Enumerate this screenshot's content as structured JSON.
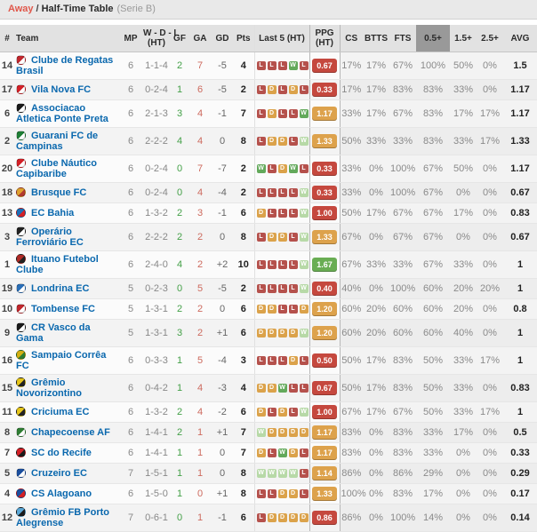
{
  "title": {
    "away": "Away",
    "sep": "/",
    "main": "Half-Time Table",
    "league": "(Serie B)"
  },
  "columns": {
    "num": "#",
    "team": "Team",
    "mp": "MP",
    "wdl1": "W - D - L",
    "wdl2": "(HT)",
    "gf": "GF",
    "ga": "GA",
    "gd": "GD",
    "pts": "Pts",
    "last5": "Last 5 (HT)",
    "ppg1": "PPG",
    "ppg2": "(HT)",
    "cs": "CS",
    "btts": "BTTS",
    "fts": "FTS",
    "o05": "0.5+",
    "o15": "1.5+",
    "o25": "2.5+",
    "avg": "AVG"
  },
  "colors": {
    "accent_away": "#e0584b",
    "team_link": "#0a68ae",
    "gf_green": "#44a048",
    "ga_red": "#cd6a5e",
    "win_box": "#63a95b",
    "win_box_light": "#b7d9a7",
    "draw_box": "#dba24a",
    "loss_box": "#b5514c",
    "ppg_red": "#c5483e",
    "ppg_orange": "#dda24c",
    "ppg_green": "#69ad53",
    "highlight_col_bg": "#999999"
  },
  "rows": [
    {
      "num": "14",
      "team": "Clube de Regatas Brasil",
      "crest": [
        "#c1272d",
        "#ffffff"
      ],
      "mp": "6",
      "wdl": "1-1-4",
      "gf": "2",
      "ga": "7",
      "gd": "-5",
      "pts": "4",
      "last5": [
        {
          "r": "L"
        },
        {
          "r": "L"
        },
        {
          "r": "L"
        },
        {
          "r": "W"
        },
        {
          "r": "L"
        }
      ],
      "ppg": "0.67",
      "ppg_color": "red",
      "cs": "17%",
      "btts": "17%",
      "fts": "67%",
      "o05": "100%",
      "o15": "50%",
      "o25": "0%",
      "avg": "1.5"
    },
    {
      "num": "17",
      "team": "Vila Nova FC",
      "crest": [
        "#d42027",
        "#ffffff"
      ],
      "mp": "6",
      "wdl": "0-2-4",
      "gf": "1",
      "ga": "6",
      "gd": "-5",
      "pts": "2",
      "last5": [
        {
          "r": "L"
        },
        {
          "r": "D"
        },
        {
          "r": "L"
        },
        {
          "r": "D"
        },
        {
          "r": "L"
        }
      ],
      "ppg": "0.33",
      "ppg_color": "red",
      "cs": "17%",
      "btts": "17%",
      "fts": "83%",
      "o05": "83%",
      "o15": "33%",
      "o25": "0%",
      "avg": "1.17"
    },
    {
      "num": "6",
      "team": "Associacao Atletica Ponte Preta",
      "crest": [
        "#1a1a1a",
        "#ffffff"
      ],
      "mp": "6",
      "wdl": "2-1-3",
      "gf": "3",
      "ga": "4",
      "gd": "-1",
      "pts": "7",
      "last5": [
        {
          "r": "L"
        },
        {
          "r": "D"
        },
        {
          "r": "L"
        },
        {
          "r": "L"
        },
        {
          "r": "W"
        }
      ],
      "ppg": "1.17",
      "ppg_color": "orange",
      "cs": "33%",
      "btts": "17%",
      "fts": "67%",
      "o05": "83%",
      "o15": "17%",
      "o25": "17%",
      "avg": "1.17"
    },
    {
      "num": "2",
      "team": "Guarani FC de Campinas",
      "crest": [
        "#1e7e34",
        "#ffffff"
      ],
      "mp": "6",
      "wdl": "2-2-2",
      "gf": "4",
      "ga": "4",
      "gd": "0",
      "pts": "8",
      "last5": [
        {
          "r": "L"
        },
        {
          "r": "D"
        },
        {
          "r": "D"
        },
        {
          "r": "L"
        },
        {
          "r": "W",
          "light": true
        }
      ],
      "ppg": "1.33",
      "ppg_color": "orange",
      "cs": "50%",
      "btts": "33%",
      "fts": "33%",
      "o05": "83%",
      "o15": "33%",
      "o25": "17%",
      "avg": "1.33"
    },
    {
      "num": "20",
      "team": "Clube Náutico Capibaribe",
      "crest": [
        "#d42027",
        "#ffffff"
      ],
      "mp": "6",
      "wdl": "0-2-4",
      "gf": "0",
      "ga": "7",
      "gd": "-7",
      "pts": "2",
      "last5": [
        {
          "r": "W"
        },
        {
          "r": "L"
        },
        {
          "r": "D"
        },
        {
          "r": "W"
        },
        {
          "r": "L"
        }
      ],
      "ppg": "0.33",
      "ppg_color": "red",
      "cs": "33%",
      "btts": "0%",
      "fts": "100%",
      "o05": "67%",
      "o15": "50%",
      "o25": "0%",
      "avg": "1.17"
    },
    {
      "num": "18",
      "team": "Brusque FC",
      "crest": [
        "#e0a22e",
        "#b23a2f"
      ],
      "mp": "6",
      "wdl": "0-2-4",
      "gf": "0",
      "ga": "4",
      "gd": "-4",
      "pts": "2",
      "last5": [
        {
          "r": "L"
        },
        {
          "r": "L"
        },
        {
          "r": "L"
        },
        {
          "r": "L"
        },
        {
          "r": "W",
          "light": true
        }
      ],
      "ppg": "0.33",
      "ppg_color": "red",
      "cs": "33%",
      "btts": "0%",
      "fts": "100%",
      "o05": "67%",
      "o15": "0%",
      "o25": "0%",
      "avg": "0.67"
    },
    {
      "num": "13",
      "team": "EC Bahia",
      "crest": [
        "#1d6fb8",
        "#d42027"
      ],
      "mp": "6",
      "wdl": "1-3-2",
      "gf": "2",
      "ga": "3",
      "gd": "-1",
      "pts": "6",
      "last5": [
        {
          "r": "D"
        },
        {
          "r": "L"
        },
        {
          "r": "L"
        },
        {
          "r": "L"
        },
        {
          "r": "W",
          "light": true
        }
      ],
      "ppg": "1.00",
      "ppg_color": "red",
      "cs": "50%",
      "btts": "17%",
      "fts": "67%",
      "o05": "67%",
      "o15": "17%",
      "o25": "0%",
      "avg": "0.83"
    },
    {
      "num": "3",
      "team": "Operário Ferroviário EC",
      "crest": [
        "#222222",
        "#ffffff"
      ],
      "mp": "6",
      "wdl": "2-2-2",
      "gf": "2",
      "ga": "2",
      "gd": "0",
      "pts": "8",
      "last5": [
        {
          "r": "L"
        },
        {
          "r": "D"
        },
        {
          "r": "D"
        },
        {
          "r": "L"
        },
        {
          "r": "W",
          "light": true
        }
      ],
      "ppg": "1.33",
      "ppg_color": "orange",
      "cs": "67%",
      "btts": "0%",
      "fts": "67%",
      "o05": "67%",
      "o15": "0%",
      "o25": "0%",
      "avg": "0.67"
    },
    {
      "num": "1",
      "team": "Ituano Futebol Clube",
      "crest": [
        "#b02a26",
        "#222222"
      ],
      "mp": "6",
      "wdl": "2-4-0",
      "gf": "4",
      "ga": "2",
      "gd": "+2",
      "pts": "10",
      "last5": [
        {
          "r": "L"
        },
        {
          "r": "L"
        },
        {
          "r": "L"
        },
        {
          "r": "L"
        },
        {
          "r": "W",
          "light": true
        }
      ],
      "ppg": "1.67",
      "ppg_color": "green",
      "cs": "67%",
      "btts": "33%",
      "fts": "33%",
      "o05": "67%",
      "o15": "33%",
      "o25": "0%",
      "avg": "1"
    },
    {
      "num": "19",
      "team": "Londrina EC",
      "crest": [
        "#2a6fb8",
        "#ffffff"
      ],
      "mp": "5",
      "wdl": "0-2-3",
      "gf": "0",
      "ga": "5",
      "gd": "-5",
      "pts": "2",
      "last5": [
        {
          "r": "L"
        },
        {
          "r": "L"
        },
        {
          "r": "L"
        },
        {
          "r": "L"
        },
        {
          "r": "W",
          "light": true
        }
      ],
      "ppg": "0.40",
      "ppg_color": "red",
      "cs": "40%",
      "btts": "0%",
      "fts": "100%",
      "o05": "60%",
      "o15": "20%",
      "o25": "20%",
      "avg": "1"
    },
    {
      "num": "10",
      "team": "Tombense FC",
      "crest": [
        "#c1272d",
        "#ffffff"
      ],
      "mp": "5",
      "wdl": "1-3-1",
      "gf": "2",
      "ga": "2",
      "gd": "0",
      "pts": "6",
      "last5": [
        {
          "r": "D"
        },
        {
          "r": "D"
        },
        {
          "r": "L"
        },
        {
          "r": "L"
        },
        {
          "r": "D"
        }
      ],
      "ppg": "1.20",
      "ppg_color": "orange",
      "cs": "60%",
      "btts": "20%",
      "fts": "60%",
      "o05": "60%",
      "o15": "20%",
      "o25": "0%",
      "avg": "0.8"
    },
    {
      "num": "9",
      "team": "CR Vasco da Gama",
      "crest": [
        "#1a1a1a",
        "#ffffff"
      ],
      "mp": "5",
      "wdl": "1-3-1",
      "gf": "3",
      "ga": "2",
      "gd": "+1",
      "pts": "6",
      "last5": [
        {
          "r": "D"
        },
        {
          "r": "D"
        },
        {
          "r": "D"
        },
        {
          "r": "D"
        },
        {
          "r": "W",
          "light": true
        }
      ],
      "ppg": "1.20",
      "ppg_color": "orange",
      "cs": "60%",
      "btts": "20%",
      "fts": "60%",
      "o05": "60%",
      "o15": "40%",
      "o25": "0%",
      "avg": "1"
    },
    {
      "num": "16",
      "team": "Sampaio Corrêa FC",
      "crest": [
        "#d4b012",
        "#2e7d32"
      ],
      "mp": "6",
      "wdl": "0-3-3",
      "gf": "1",
      "ga": "5",
      "gd": "-4",
      "pts": "3",
      "last5": [
        {
          "r": "L"
        },
        {
          "r": "L"
        },
        {
          "r": "L"
        },
        {
          "r": "D"
        },
        {
          "r": "L"
        }
      ],
      "ppg": "0.50",
      "ppg_color": "red",
      "cs": "50%",
      "btts": "17%",
      "fts": "83%",
      "o05": "50%",
      "o15": "33%",
      "o25": "17%",
      "avg": "1"
    },
    {
      "num": "15",
      "team": "Grêmio Novorizontino",
      "crest": [
        "#e6c619",
        "#222222"
      ],
      "mp": "6",
      "wdl": "0-4-2",
      "gf": "1",
      "ga": "4",
      "gd": "-3",
      "pts": "4",
      "last5": [
        {
          "r": "D"
        },
        {
          "r": "D"
        },
        {
          "r": "W"
        },
        {
          "r": "L"
        },
        {
          "r": "L"
        }
      ],
      "ppg": "0.67",
      "ppg_color": "red",
      "cs": "50%",
      "btts": "17%",
      "fts": "83%",
      "o05": "50%",
      "o15": "33%",
      "o25": "0%",
      "avg": "0.83"
    },
    {
      "num": "11",
      "team": "Criciuma EC",
      "crest": [
        "#e6c619",
        "#222222"
      ],
      "mp": "6",
      "wdl": "1-3-2",
      "gf": "2",
      "ga": "4",
      "gd": "-2",
      "pts": "6",
      "last5": [
        {
          "r": "D"
        },
        {
          "r": "L"
        },
        {
          "r": "D"
        },
        {
          "r": "L"
        },
        {
          "r": "W",
          "light": true
        }
      ],
      "ppg": "1.00",
      "ppg_color": "red",
      "cs": "67%",
      "btts": "17%",
      "fts": "67%",
      "o05": "50%",
      "o15": "33%",
      "o25": "17%",
      "avg": "1"
    },
    {
      "num": "8",
      "team": "Chapecoense AF",
      "crest": [
        "#2e7d32",
        "#ffffff"
      ],
      "mp": "6",
      "wdl": "1-4-1",
      "gf": "2",
      "ga": "1",
      "gd": "+1",
      "pts": "7",
      "last5": [
        {
          "r": "W",
          "light": true
        },
        {
          "r": "D"
        },
        {
          "r": "D"
        },
        {
          "r": "D"
        },
        {
          "r": "D"
        }
      ],
      "ppg": "1.17",
      "ppg_color": "orange",
      "cs": "83%",
      "btts": "0%",
      "fts": "83%",
      "o05": "33%",
      "o15": "17%",
      "o25": "0%",
      "avg": "0.5"
    },
    {
      "num": "7",
      "team": "SC do Recife",
      "crest": [
        "#d42027",
        "#1a1a1a"
      ],
      "mp": "6",
      "wdl": "1-4-1",
      "gf": "1",
      "ga": "1",
      "gd": "0",
      "pts": "7",
      "last5": [
        {
          "r": "D"
        },
        {
          "r": "L"
        },
        {
          "r": "W"
        },
        {
          "r": "D"
        },
        {
          "r": "L"
        }
      ],
      "ppg": "1.17",
      "ppg_color": "orange",
      "cs": "83%",
      "btts": "0%",
      "fts": "83%",
      "o05": "33%",
      "o15": "0%",
      "o25": "0%",
      "avg": "0.33"
    },
    {
      "num": "5",
      "team": "Cruzeiro EC",
      "crest": [
        "#1a4e9e",
        "#ffffff"
      ],
      "mp": "7",
      "wdl": "1-5-1",
      "gf": "1",
      "ga": "1",
      "gd": "0",
      "pts": "8",
      "last5": [
        {
          "r": "W",
          "light": true
        },
        {
          "r": "W",
          "light": true
        },
        {
          "r": "W",
          "light": true
        },
        {
          "r": "W",
          "light": true
        },
        {
          "r": "L"
        }
      ],
      "ppg": "1.14",
      "ppg_color": "orange",
      "cs": "86%",
      "btts": "0%",
      "fts": "86%",
      "o05": "29%",
      "o15": "0%",
      "o25": "0%",
      "avg": "0.29"
    },
    {
      "num": "4",
      "team": "CS Alagoano",
      "crest": [
        "#1d4f9e",
        "#d42027"
      ],
      "mp": "6",
      "wdl": "1-5-0",
      "gf": "1",
      "ga": "0",
      "gd": "+1",
      "pts": "8",
      "last5": [
        {
          "r": "L"
        },
        {
          "r": "L"
        },
        {
          "r": "D"
        },
        {
          "r": "D"
        },
        {
          "r": "L"
        }
      ],
      "ppg": "1.33",
      "ppg_color": "orange",
      "cs": "100%",
      "btts": "0%",
      "fts": "83%",
      "o05": "17%",
      "o15": "0%",
      "o25": "0%",
      "avg": "0.17"
    },
    {
      "num": "12",
      "team": "Grêmio FB Porto Alegrense",
      "crest": [
        "#5aa7d6",
        "#1a1a1a"
      ],
      "mp": "7",
      "wdl": "0-6-1",
      "gf": "0",
      "ga": "1",
      "gd": "-1",
      "pts": "6",
      "last5": [
        {
          "r": "L"
        },
        {
          "r": "D"
        },
        {
          "r": "D"
        },
        {
          "r": "D"
        },
        {
          "r": "D"
        }
      ],
      "ppg": "0.86",
      "ppg_color": "red",
      "cs": "86%",
      "btts": "0%",
      "fts": "100%",
      "o05": "14%",
      "o15": "0%",
      "o25": "0%",
      "avg": "0.14"
    }
  ]
}
